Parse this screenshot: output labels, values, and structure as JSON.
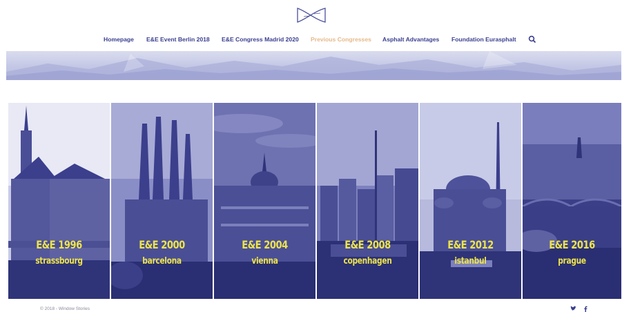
{
  "nav": {
    "items": [
      {
        "label": "Homepage"
      },
      {
        "label": "E&E Event Berlin 2018"
      },
      {
        "label": "E&E Congress Madrid 2020"
      },
      {
        "label": "Previous Congresses"
      },
      {
        "label": "Asphalt Advantages"
      },
      {
        "label": "Foundation Eurasphalt"
      }
    ],
    "active_item": "Previous Congresses"
  },
  "panels": [
    {
      "title": "E&E 1996",
      "city": "strassbourg"
    },
    {
      "title": "E&E 2000",
      "city": "barcelona"
    },
    {
      "title": "E&E 2004",
      "city": "vienna"
    },
    {
      "title": "E&E 2008",
      "city": "copenhagen"
    },
    {
      "title": "E&E 2012",
      "city": "istanbul"
    },
    {
      "title": "E&E 2016",
      "city": "prague"
    }
  ],
  "footer": {
    "copyright": "© 2018 - Window Stories",
    "social": [
      "twitter-icon",
      "facebook-icon"
    ]
  },
  "colors": {
    "nav_text": "#3b3f8f",
    "nav_active": "#e7b98a",
    "panel_tint": "#3a3e8c",
    "panel_title": "#ece34b"
  }
}
